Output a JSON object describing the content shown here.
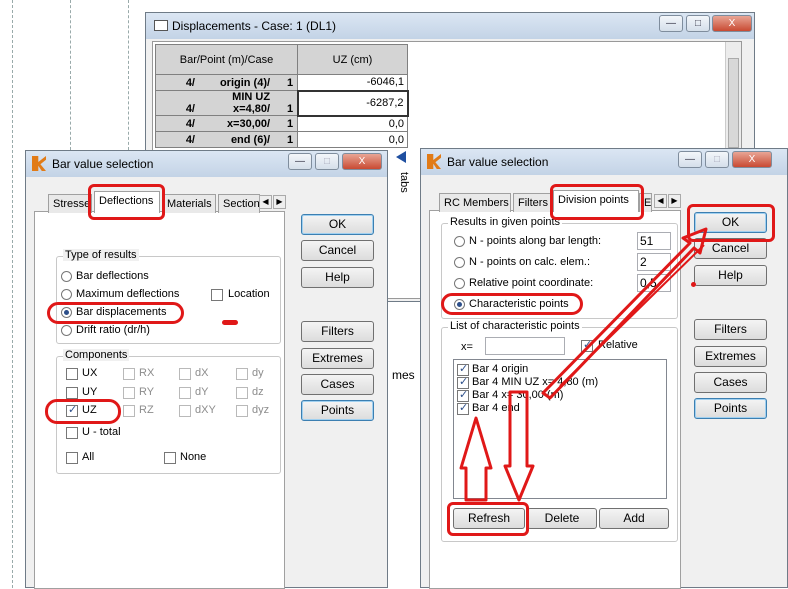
{
  "displacements": {
    "title": "Displacements - Case: 1 (DL1)",
    "col_headers": [
      "Bar/Point (m)/Case",
      "UZ (cm)"
    ],
    "rows": [
      {
        "bar": "4/",
        "point": "origin (4)/",
        "case": "1",
        "uz": "-6046,1"
      },
      {
        "bar": "4/",
        "point": "MIN UZ x=4,80/",
        "case": "1",
        "uz": "-6287,2"
      },
      {
        "bar": "4/",
        "point": "x=30,00/",
        "case": "1",
        "uz": "0,0"
      },
      {
        "bar": "4/",
        "point": "end (6)/",
        "case": "1",
        "uz": "0,0"
      }
    ]
  },
  "side_labels": {
    "tabs": "tabs",
    "mes": "mes"
  },
  "left_dialog": {
    "title": "Bar value selection",
    "tabs": [
      "Stresse",
      "Deflections",
      "Materials",
      "Section"
    ],
    "type_group": "Type of results",
    "types": [
      "Bar deflections",
      "Maximum deflections",
      "Bar displacements",
      "Drift ratio (dr/h)"
    ],
    "location": "Location",
    "components_group": "Components",
    "components": [
      [
        "UX",
        "RX",
        "dX",
        "dy"
      ],
      [
        "UY",
        "RY",
        "dY",
        "dz"
      ],
      [
        "UZ",
        "RZ",
        "dXY",
        "dyz"
      ]
    ],
    "u_total": "U - total",
    "all": "All",
    "none": "None",
    "buttons": {
      "ok": "OK",
      "cancel": "Cancel",
      "help": "Help",
      "filters": "Filters",
      "extremes": "Extremes",
      "cases": "Cases",
      "points": "Points"
    }
  },
  "right_dialog": {
    "title": "Bar value selection",
    "tabs": [
      "RC Members",
      "Filters",
      "Division points",
      "E"
    ],
    "results_group": "Results in given points",
    "options": [
      {
        "label": "N - points along bar length:",
        "value": "51"
      },
      {
        "label": "N - points on calc. elem.:",
        "value": "2"
      },
      {
        "label": "Relative point coordinate:",
        "value": "0,5"
      },
      {
        "label": "Characteristic points",
        "value": ""
      }
    ],
    "list_group": "List of characteristic points",
    "x_label": "x=",
    "relative": "Relative",
    "points": [
      "Bar 4 origin",
      "Bar 4 MIN UZ x= 4,80 (m)",
      "Bar 4 x= 30,00 (m)",
      "Bar 4 end"
    ],
    "list_buttons": {
      "refresh": "Refresh",
      "delete": "Delete",
      "add": "Add"
    },
    "buttons": {
      "ok": "OK",
      "cancel": "Cancel",
      "help": "Help",
      "filters": "Filters",
      "extremes": "Extremes",
      "cases": "Cases",
      "points": "Points"
    }
  },
  "window_buttons": {
    "minimize": "—",
    "maximize": "□",
    "close": "X"
  }
}
